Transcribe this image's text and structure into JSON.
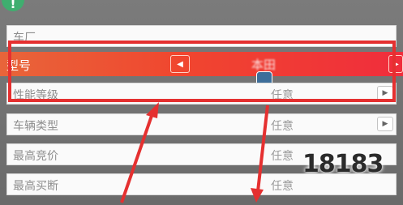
{
  "header": {
    "badge_glyph": "!"
  },
  "rows": {
    "brand": {
      "label": "车厂",
      "value": ""
    },
    "model": {
      "label": "型号",
      "value": "本田"
    },
    "performance": {
      "label": "性能等级",
      "value": "任意"
    },
    "vehicle_type": {
      "label": "车辆类型",
      "value": "任意"
    },
    "max_bid": {
      "label": "最高竞价",
      "value": "任意"
    },
    "max_buyout": {
      "label": "最高买断",
      "value": "任意"
    }
  },
  "controls": {
    "prev_glyph": "◀",
    "next_glyph": "▶",
    "row_arrow_glyph": "▶"
  },
  "watermark": {
    "text": "18183"
  },
  "colors": {
    "highlight_gradient_start": "#e8653a",
    "highlight_gradient_end": "#f02d3c",
    "annotation_red": "#e53030"
  }
}
